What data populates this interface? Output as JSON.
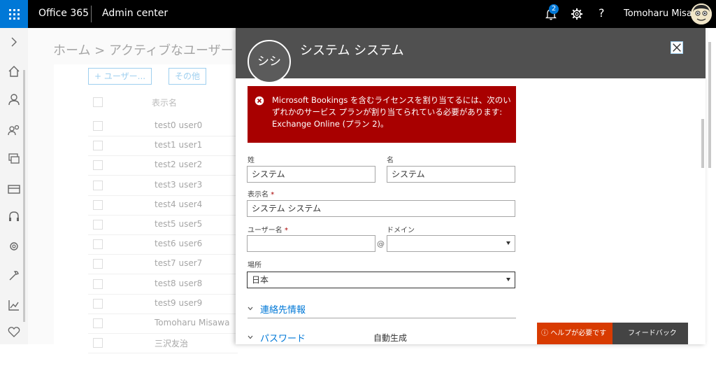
{
  "topbar": {
    "brand": "Office 365",
    "app": "Admin center",
    "notification_count": "2",
    "help_glyph": "?",
    "user_name": "Tomoharu Misawa",
    "icons": [
      "app-launcher-icon",
      "bell-icon",
      "gear-icon",
      "help-icon",
      "avatar"
    ]
  },
  "rail": {
    "icons": [
      "expand-chevron-icon",
      "home-icon",
      "user-icon",
      "group-icon",
      "resources-icon",
      "billing-icon",
      "support-icon",
      "settings-icon",
      "setup-icon",
      "reports-icon",
      "health-icon"
    ]
  },
  "background": {
    "breadcrumb": "ホーム > アクティブなユーザー",
    "add_user_button": "+ ユーザー...",
    "more_button": "その他",
    "column_header": "表示名",
    "rows": [
      "test0 user0",
      "test1 user1",
      "test2 user2",
      "test3 user3",
      "test4 user4",
      "test5 user5",
      "test6 user6",
      "test7 user7",
      "test8 user8",
      "test9 user9",
      "Tomoharu Misawa",
      "三沢友治"
    ]
  },
  "panel": {
    "persona_initials": "シシ",
    "title": "システム システム",
    "error_message": "Microsoft Bookings を含むライセンスを割り当てるには、次のいずれかのサービス プランが割り当てられている必要があります: Exchange Online (プラン 2)。",
    "form": {
      "last_name_label": "姓",
      "last_name_value": "システム",
      "first_name_label": "名",
      "first_name_value": "システム",
      "display_name_label": "表示名",
      "display_name_value": "システム システム",
      "required_mark": "*",
      "username_label": "ユーザー名",
      "username_value": "",
      "at_sign": "@",
      "domain_label": "ドメイン",
      "domain_value": "",
      "location_label": "場所",
      "location_value": "日本"
    },
    "sections": {
      "contact_info": "連絡先情報",
      "password": "パスワード",
      "password_value": "自動生成"
    }
  },
  "footer": {
    "help_button": "ヘルプが必要ですか?",
    "feedback_button": "フィードバック"
  },
  "colors": {
    "accent": "#0078d7",
    "error_bg": "#a80000",
    "panel_header": "#505050",
    "help_button": "#d83b01"
  }
}
